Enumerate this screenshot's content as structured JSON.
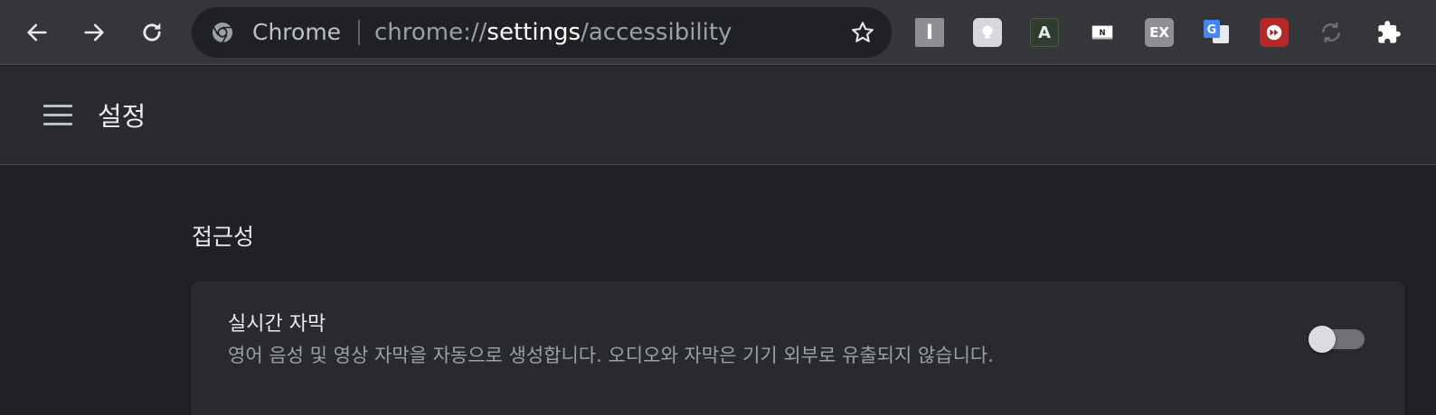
{
  "browser": {
    "omnibox": {
      "chip_label": "Chrome",
      "url_scheme": "chrome://",
      "url_host": "settings",
      "url_path": "/accessibility"
    },
    "extensions": [
      {
        "name": "i-extension-icon",
        "label": "I"
      },
      {
        "name": "lightbulb-extension-icon"
      },
      {
        "name": "a-extension-icon",
        "label": "A"
      },
      {
        "name": "n-extension-icon",
        "label": "N"
      },
      {
        "name": "ex-extension-icon",
        "label": "EX"
      },
      {
        "name": "google-translate-icon",
        "label": "G"
      },
      {
        "name": "fast-forward-extension-icon"
      },
      {
        "name": "sync-icon"
      },
      {
        "name": "puzzle-extensions-icon"
      }
    ]
  },
  "settings": {
    "title": "설정"
  },
  "section": {
    "title": "접근성",
    "rows": [
      {
        "title": "실시간 자막",
        "description": "영어 음성 및 영상 자막을 자동으로 생성합니다. 오디오와 자막은 기기 외부로 유출되지 않습니다.",
        "enabled": false
      }
    ]
  },
  "colors": {
    "toolbar_bg": "#35363a",
    "page_bg": "#202124",
    "header_bg": "#292a2d",
    "card_bg": "#292a2d",
    "text_primary": "#e8eaed",
    "text_secondary": "#9aa0a6",
    "toggle_off_track": "#6f7175",
    "toggle_off_knob": "#dadce0"
  }
}
